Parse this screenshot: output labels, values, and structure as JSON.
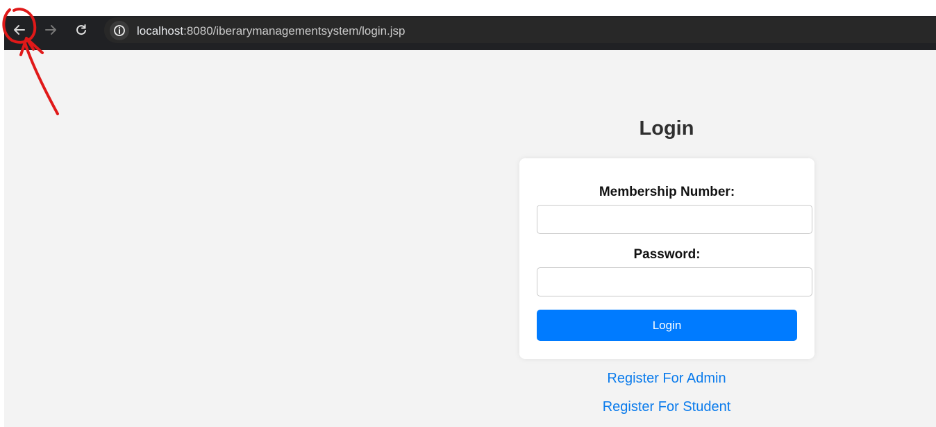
{
  "browser": {
    "url_host": "localhost",
    "url_rest": ":8080/iberarymanagementsystem/login.jsp",
    "back_icon": "arrow-left-icon",
    "forward_icon": "arrow-right-icon",
    "reload_icon": "reload-icon",
    "info_icon": "info-icon"
  },
  "page": {
    "title": "Login",
    "form": {
      "membership_label": "Membership Number:",
      "membership_value": "",
      "password_label": "Password:",
      "password_value": "",
      "login_button": "Login"
    },
    "links": {
      "register_admin": "Register For Admin",
      "register_student": "Register For Student"
    }
  },
  "colors": {
    "browser_bar": "#202124",
    "page_background": "#f3f3f3",
    "primary_button": "#007bff",
    "link": "#0a7bec",
    "annotation_red": "#e01919"
  }
}
